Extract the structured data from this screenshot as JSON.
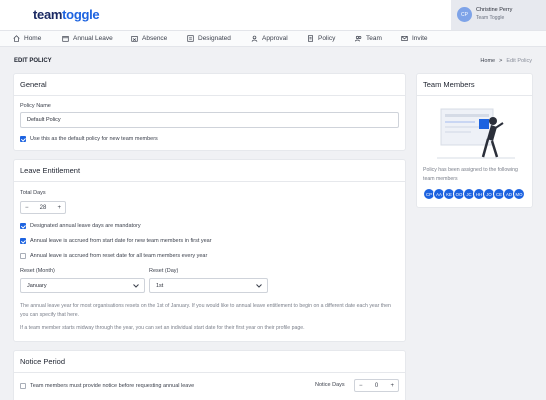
{
  "brand": {
    "logo_part1": "team",
    "logo_part2": "toggle"
  },
  "user": {
    "initials": "CP",
    "name": "Christine Perry",
    "team": "Team Toggle"
  },
  "nav": [
    {
      "label": "Home",
      "icon": "home-icon"
    },
    {
      "label": "Annual Leave",
      "icon": "calendar-icon"
    },
    {
      "label": "Absence",
      "icon": "absence-icon"
    },
    {
      "label": "Designated",
      "icon": "designated-icon"
    },
    {
      "label": "Approval",
      "icon": "approval-icon"
    },
    {
      "label": "Policy",
      "icon": "policy-icon"
    },
    {
      "label": "Team",
      "icon": "team-icon"
    },
    {
      "label": "Invite",
      "icon": "invite-icon"
    }
  ],
  "page": {
    "title": "EDIT POLICY",
    "breadcrumb_home": "Home",
    "breadcrumb_sep": ">",
    "breadcrumb_current": "Edit Policy"
  },
  "general": {
    "title": "General",
    "policy_name_label": "Policy Name",
    "policy_name_value": "Default Policy",
    "default_checkbox_label": "Use this as the default policy for new team members"
  },
  "leave": {
    "title": "Leave Entitlement",
    "total_days_label": "Total Days",
    "total_days_value": "28",
    "minus": "−",
    "plus": "+",
    "cb_mandatory": "Designated annual leave days are mandatory",
    "cb_accrued_start": "Annual leave is accrued from start date for new team members in first year",
    "cb_accrued_reset": "Annual leave is accrued from reset date for all team members every year",
    "reset_month_label": "Reset (Month)",
    "reset_month_value": "January",
    "reset_day_label": "Reset (Day)",
    "reset_day_value": "1st",
    "note1": "The annual leave year for most organisations resets on the 1st of January. If you would like to annual leave entitlement to begin on a different date each year then you can specify that here.",
    "note2": "If a team member starts midway through the year, you can set an individual start date for their first year on their profile page."
  },
  "notice": {
    "title": "Notice Period",
    "cb_label": "Team members must provide notice before requesting annual leave",
    "days_label": "Notice Days",
    "days_value": "0"
  },
  "team_members": {
    "title": "Team Members",
    "text": "Policy has been assigned to the following team members",
    "badges": [
      "CP",
      "AA",
      "KE",
      "OO",
      "JC",
      "HH",
      "JO",
      "CE",
      "AD",
      "MO"
    ]
  },
  "colors": {
    "accent": "#1d63e0",
    "brand_dark": "#1b2a63"
  }
}
